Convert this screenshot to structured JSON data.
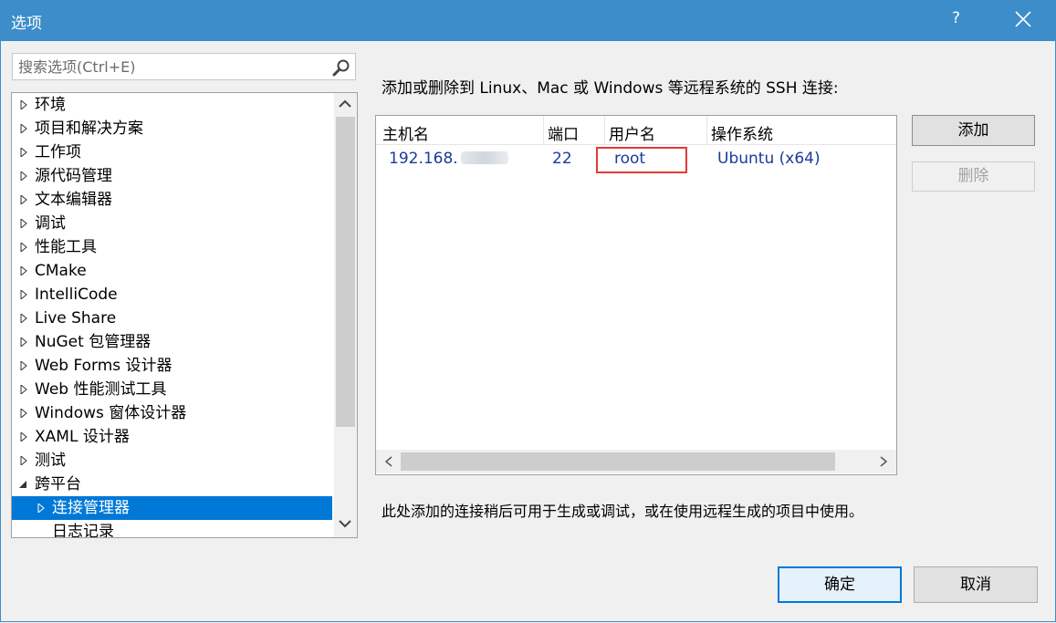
{
  "window": {
    "title": "选项",
    "help": "?"
  },
  "search": {
    "placeholder": "搜索选项(Ctrl+E)",
    "value": ""
  },
  "tree": {
    "items": [
      {
        "label": "环境",
        "expanded": false
      },
      {
        "label": "项目和解决方案",
        "expanded": false
      },
      {
        "label": "工作项",
        "expanded": false
      },
      {
        "label": "源代码管理",
        "expanded": false
      },
      {
        "label": "文本编辑器",
        "expanded": false
      },
      {
        "label": "调试",
        "expanded": false
      },
      {
        "label": "性能工具",
        "expanded": false
      },
      {
        "label": "CMake",
        "expanded": false
      },
      {
        "label": "IntelliCode",
        "expanded": false
      },
      {
        "label": "Live Share",
        "expanded": false
      },
      {
        "label": "NuGet 包管理器",
        "expanded": false
      },
      {
        "label": "Web Forms 设计器",
        "expanded": false
      },
      {
        "label": "Web 性能测试工具",
        "expanded": false
      },
      {
        "label": "Windows 窗体设计器",
        "expanded": false
      },
      {
        "label": "XAML 设计器",
        "expanded": false
      },
      {
        "label": "测试",
        "expanded": false
      },
      {
        "label": "跨平台",
        "expanded": true
      }
    ],
    "children": [
      {
        "label": "连接管理器",
        "selected": true
      },
      {
        "label": "日志记录",
        "selected": false
      }
    ]
  },
  "main": {
    "description": "添加或删除到 Linux、Mac 或 Windows 等远程系统的 SSH 连接:",
    "note": "此处添加的连接稍后可用于生成或调试，或在使用远程生成的项目中使用。",
    "columns": [
      "主机名",
      "端口",
      "用户名",
      "操作系统"
    ],
    "rows": [
      {
        "host": "192.168.",
        "port": "22",
        "user": "root",
        "os": "Ubuntu (x64)"
      }
    ]
  },
  "buttons": {
    "add": "添加",
    "remove": "删除",
    "ok": "确定",
    "cancel": "取消"
  },
  "colors": {
    "titlebar": "#3c8dc9",
    "selection": "#0078d7",
    "highlight": "#e53935",
    "link_text": "#1a3c99"
  }
}
